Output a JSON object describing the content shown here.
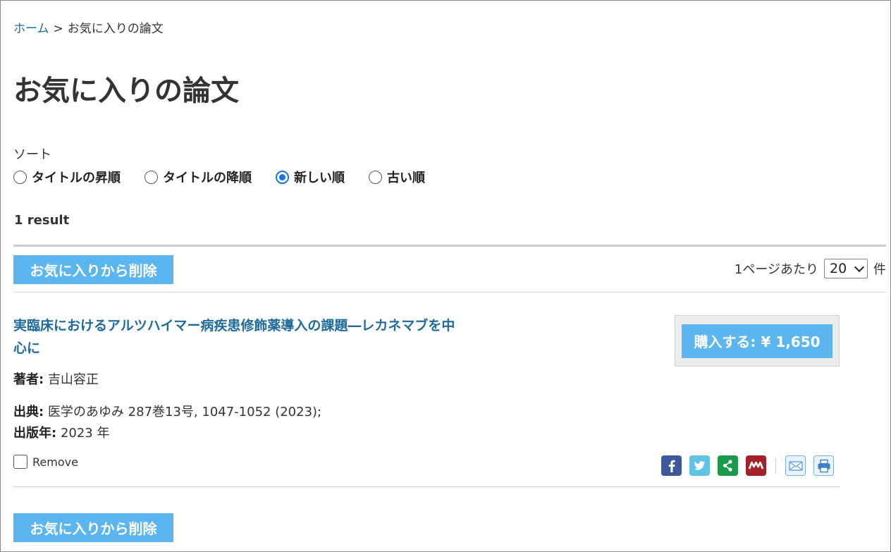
{
  "breadcrumb": {
    "home": "ホーム",
    "separator": ">",
    "current": "お気に入りの論文"
  },
  "page_title": "お気に入りの論文",
  "sort": {
    "label": "ソート",
    "options": [
      "タイトルの昇順",
      "タイトルの降順",
      "新しい順",
      "古い順"
    ],
    "selected": "新しい順"
  },
  "result_count": "1 result",
  "actions": {
    "remove_favorites": "お気に入りから削除"
  },
  "per_page": {
    "prefix": "1ページあたり",
    "value": "20",
    "suffix": "件"
  },
  "article": {
    "title": "実臨床におけるアルツハイマー病疾患修飾薬導入の課題―レカネマブを中心に",
    "authors_label": "著者:",
    "authors": "吉山容正",
    "source_label": "出典:",
    "source": "医学のあゆみ 287巻13号, 1047-1052 (2023);",
    "year_label": "出版年:",
    "year": "2023 年",
    "remove_label": "Remove",
    "buy_label": "購入する: ¥ 1,650"
  },
  "colors": {
    "link": "#1f6b9e",
    "button": "#5bb5ee",
    "radio_selected": "#1473e6"
  },
  "share_icons": [
    "facebook-icon",
    "twitter-icon",
    "share-icon",
    "mixi-icon",
    "mail-icon",
    "print-icon"
  ]
}
